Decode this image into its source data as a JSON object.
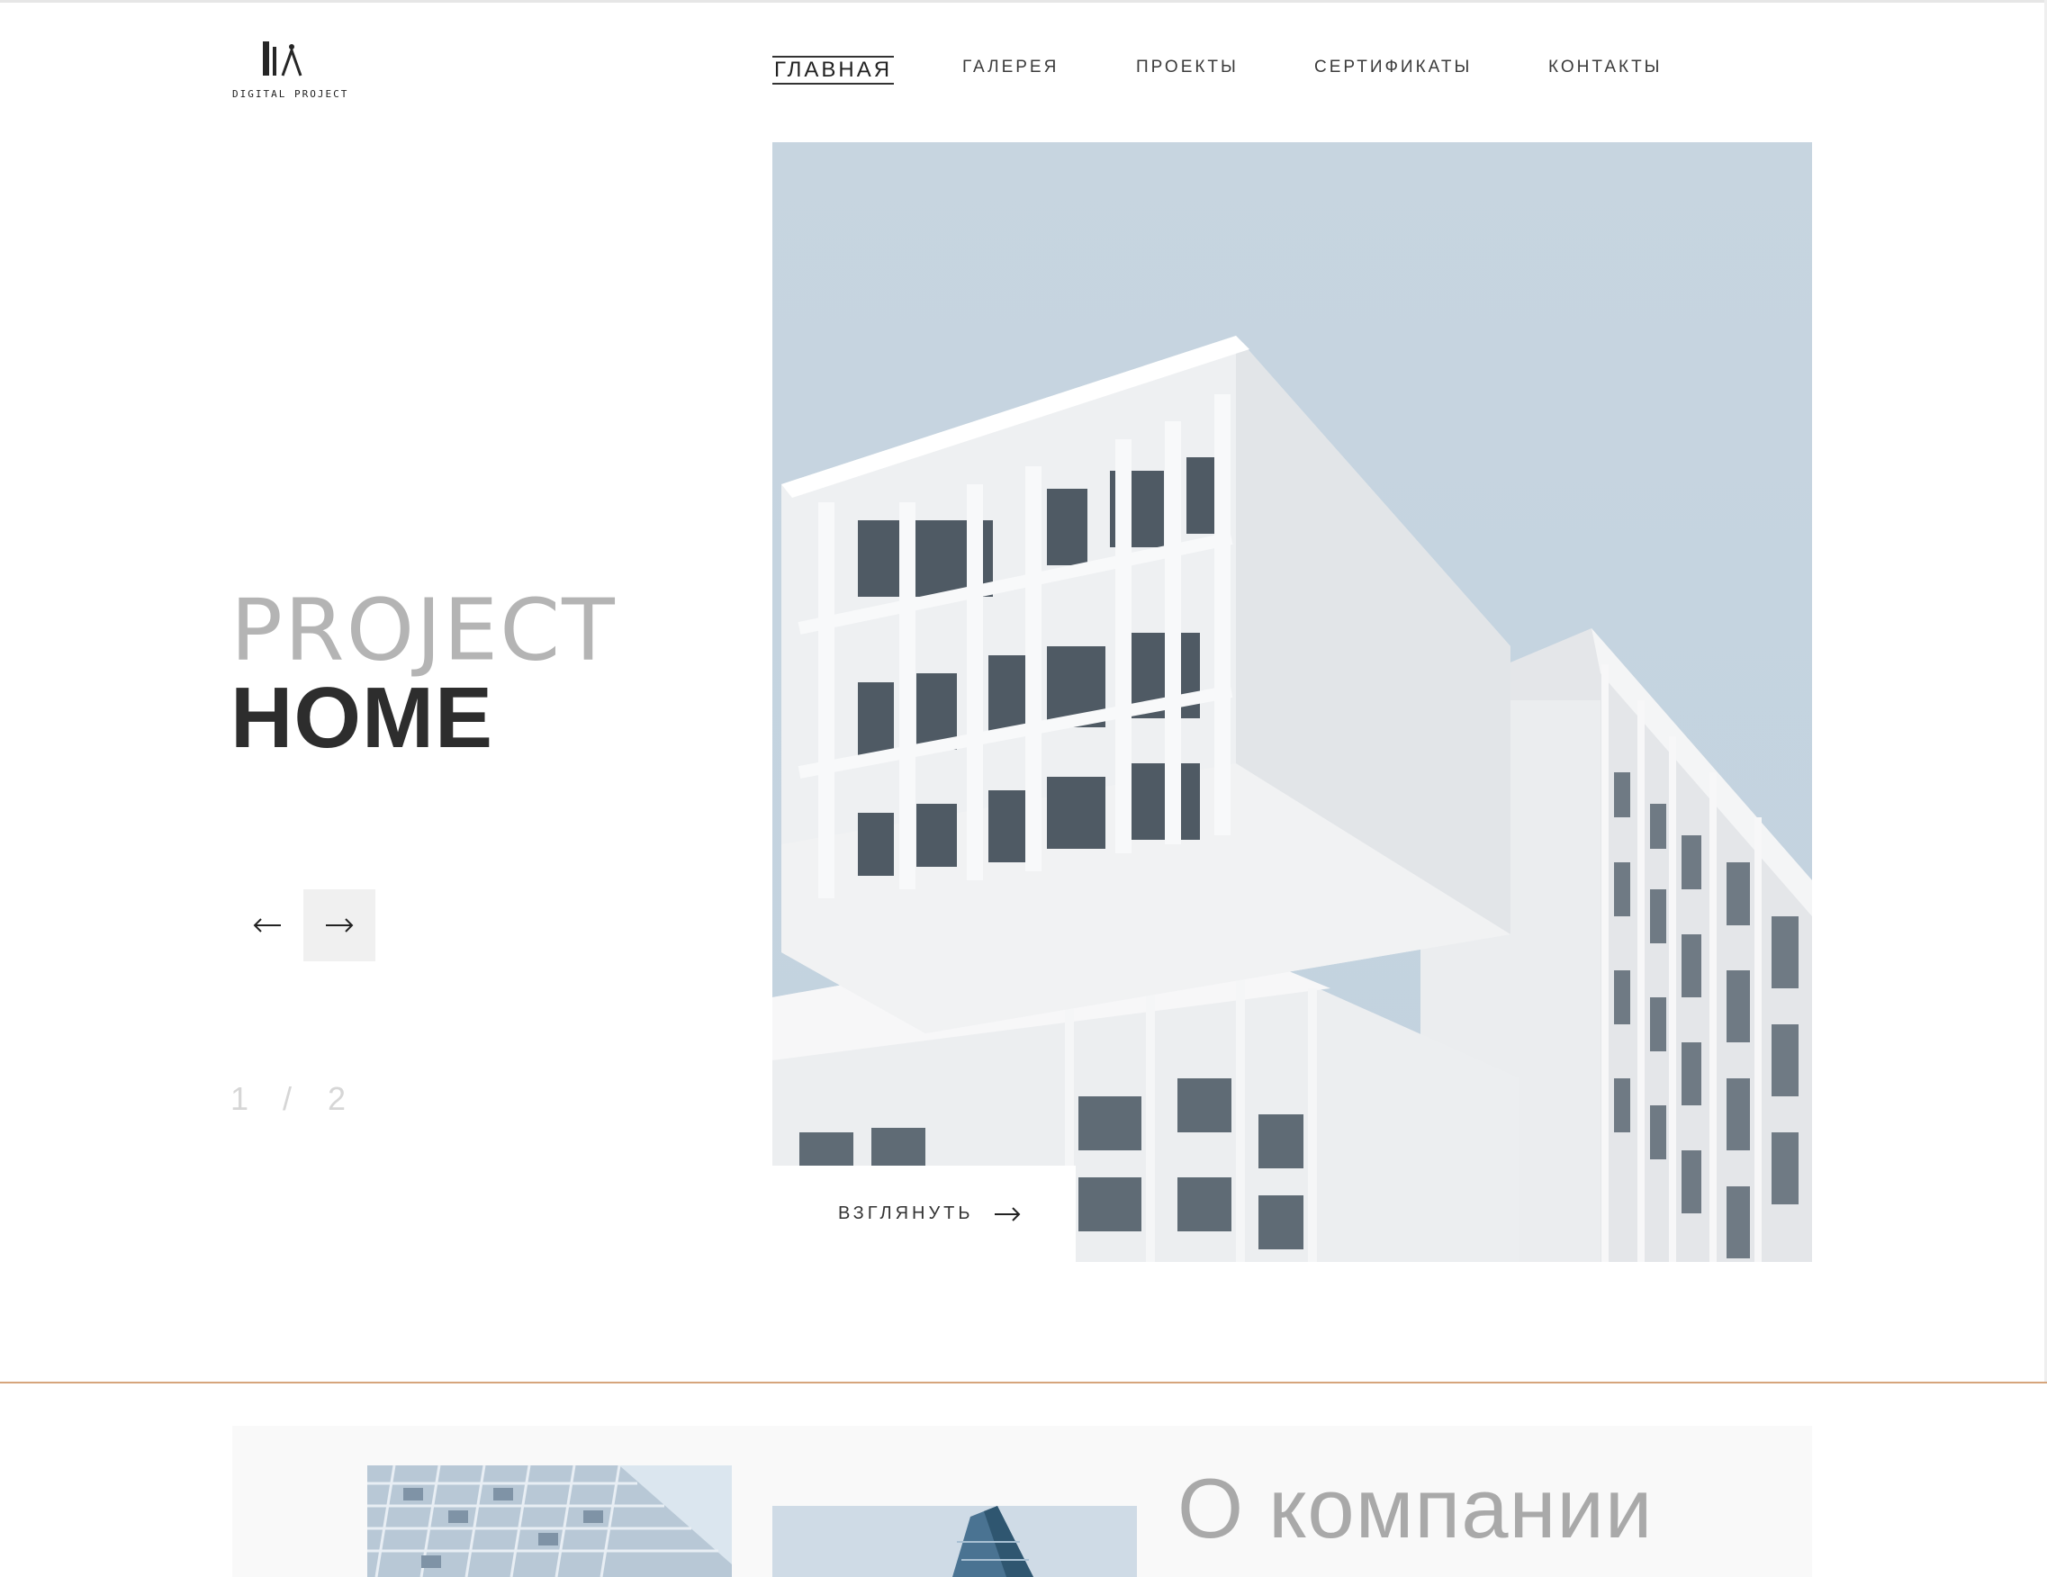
{
  "brand": {
    "logo_text": "DIGITAL PROJECT"
  },
  "nav": {
    "items": [
      {
        "label": "ГЛАВНАЯ",
        "active": true
      },
      {
        "label": "ГАЛЕРЕЯ",
        "active": false
      },
      {
        "label": "ПРОЕКТЫ",
        "active": false
      },
      {
        "label": "СЕРТИФИКАТЫ",
        "active": false
      },
      {
        "label": "КОНТАКТЫ",
        "active": false
      }
    ]
  },
  "hero": {
    "title_light": "PROJECT",
    "title_bold": "HOME",
    "slider": {
      "current": "1",
      "separator": "/",
      "total": "2"
    },
    "look_button": "ВЗГЛЯНУТЬ",
    "image_alt": "white modern apartment building against pale blue sky"
  },
  "about": {
    "title": "О компании"
  },
  "colors": {
    "accent_line": "#d6a57c",
    "hero_light_text": "#b4b4b4",
    "hero_bold_text": "#2d2d2d",
    "sky": "#c5d3df"
  },
  "icons": [
    "logo-mark-icon",
    "arrow-left-icon",
    "arrow-right-icon",
    "look-arrow-icon"
  ]
}
